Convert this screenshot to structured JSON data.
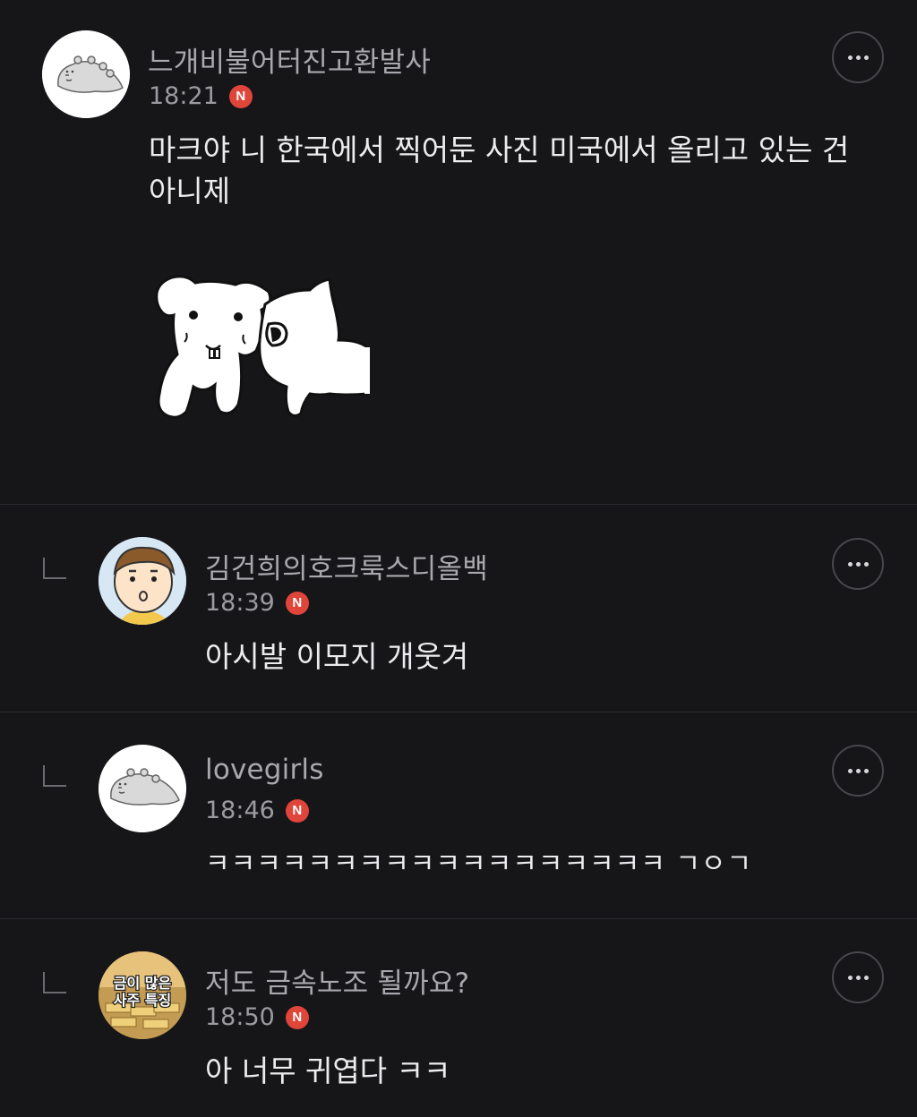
{
  "comments": [
    {
      "username": "느개비불어터진고환발사",
      "time": "18:21",
      "badge": "N",
      "text": "마크야 니 한국에서 찍어둔 사진 미국에서 올리고 있는 건 아니제",
      "avatar_icon": "dino-avatar-icon",
      "has_emoji": true
    },
    {
      "username": "김건희의호크룩스디올백",
      "time": "18:39",
      "badge": "N",
      "text": "아시발 이모지 개웃겨",
      "avatar_icon": "cartoon-boy-avatar-icon"
    },
    {
      "username": "lovegirls",
      "time": "18:46",
      "badge": "N",
      "text": "ㅋㅋㅋㅋㅋㅋㅋㅋㅋㅋㅋㅋㅋㅋㅋㅋㅋㅋ ㄱㅇㄱ",
      "avatar_icon": "dino-avatar-icon"
    },
    {
      "username": "저도 금속노조 될까요?",
      "time": "18:50",
      "badge": "N",
      "text": "아 너무 귀엽다 ㅋㅋ",
      "avatar_icon": "gold-bars-avatar-icon",
      "avatar_text_line1": "금이 많은",
      "avatar_text_line2": "사주 특징"
    }
  ],
  "colors": {
    "background": "#161619",
    "badge": "#e0453a",
    "divider": "#2c2c30"
  }
}
